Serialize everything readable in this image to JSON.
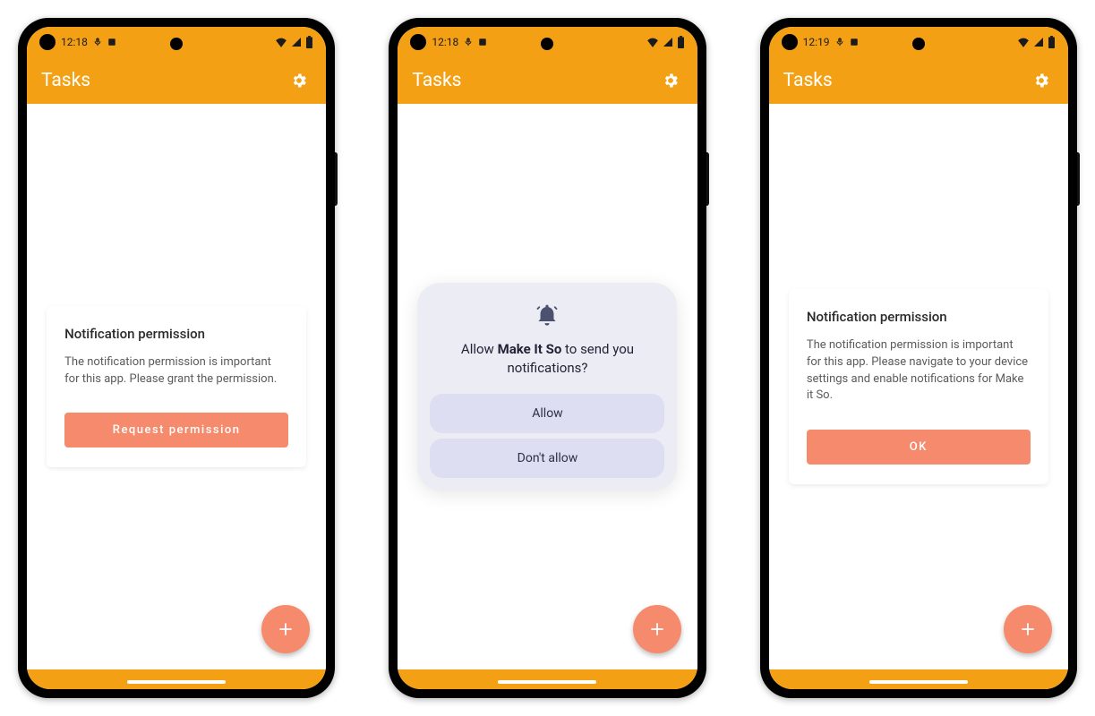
{
  "phones": [
    {
      "status": {
        "time": "12:18"
      },
      "appbar": {
        "title": "Tasks"
      },
      "card": {
        "title": "Notification permission",
        "body": "The notification permission is important for this app. Please grant the permission.",
        "button": "Request permission"
      }
    },
    {
      "status": {
        "time": "12:18"
      },
      "appbar": {
        "title": "Tasks"
      },
      "dialog": {
        "prefix": "Allow ",
        "app_name": "Make It So",
        "suffix": " to send you notifications?",
        "allow": "Allow",
        "deny": "Don't allow"
      }
    },
    {
      "status": {
        "time": "12:19"
      },
      "appbar": {
        "title": "Tasks"
      },
      "card": {
        "title": "Notification permission",
        "body": "The notification permission is important for this app. Please navigate to your device settings and enable notifications for Make it So.",
        "button": "OK"
      }
    }
  ]
}
